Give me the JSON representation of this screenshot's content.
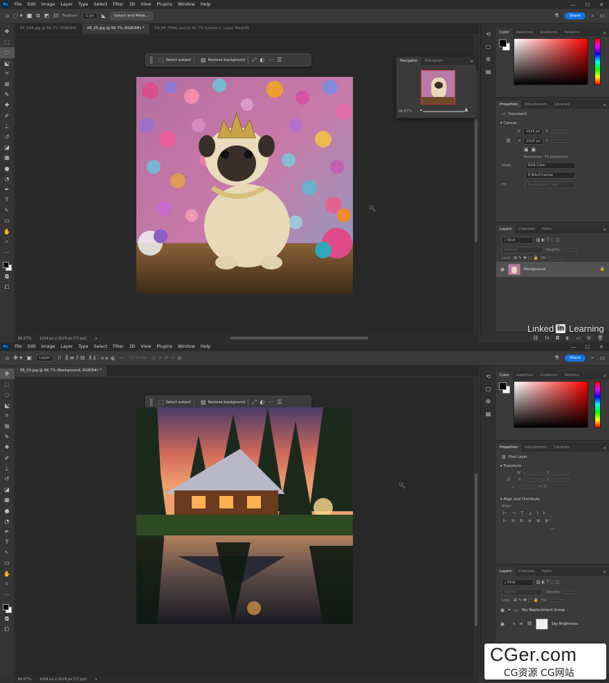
{
  "menu": [
    "File",
    "Edit",
    "Image",
    "Layer",
    "Type",
    "Select",
    "Filter",
    "3D",
    "View",
    "Plugins",
    "Window",
    "Help"
  ],
  "app_logo": "Ps",
  "window_controls": [
    "—",
    "☐",
    "✕"
  ],
  "top": {
    "options": {
      "feather_label": "Feather:",
      "feather_value": "1 px",
      "select_mask_label": "Select and Mask...",
      "share_label": "Share"
    },
    "tabs": [
      "04_04A.jpg @ 66.7% (RGB/8#)",
      "06_05.jpg @ 66.7% (RGB/8#) *",
      "04_06_FINAL.psd @ 66.7% (Levels 1, Layer Mask/8)"
    ],
    "active_tab": 1,
    "status": {
      "zoom": "66.67%",
      "dims": "1024 px x 1024 px (72 ppi)"
    },
    "ctx": {
      "select_subject": "Select subject",
      "remove_background": "Remove background"
    },
    "navigator": {
      "tabs": [
        "Navigator",
        "Histogram"
      ],
      "zoom": "66.67%"
    },
    "color_tabs": [
      "Color",
      "Swatches",
      "Gradients",
      "Patterns"
    ],
    "props_tabs": [
      "Properties",
      "Adjustments",
      "Libraries"
    ],
    "props": {
      "type_label": "Document",
      "canvas_section": "Canvas",
      "w_label": "W",
      "w_value": "1024 px",
      "h_label": "H",
      "h_value": "1024 px",
      "x_label": "X",
      "y_label": "Y",
      "resolution": "Resolution: 72 pixels/inch",
      "mode_label": "Mode",
      "mode_value": "RGB Color",
      "depth_value": "8 Bits/Channel",
      "fill_label": "Fill",
      "fill_value": "Background Color"
    },
    "layers_tabs": [
      "Layers",
      "Channels",
      "Paths"
    ],
    "layers": {
      "kind": "Kind",
      "blend": "Normal",
      "opacity_label": "Opacity:",
      "lock_label": "Lock:",
      "fill_label": "Fill:",
      "items": [
        {
          "name": "Background"
        }
      ]
    }
  },
  "bottom": {
    "options": {
      "layer_select": "Layer",
      "share_label": "Share",
      "mode_3d": "3D Mode:"
    },
    "tabs": [
      "06_03.jpg @ 66.7% (Background, RGB/8#) *"
    ],
    "active_tab": 0,
    "status": {
      "zoom": "66.67%",
      "dims": "1024 px x 1024 px (72 ppi)"
    },
    "ctx": {
      "select_subject": "Select subject",
      "remove_background": "Remove background"
    },
    "color_tabs": [
      "Color",
      "Swatches",
      "Gradients",
      "Patterns"
    ],
    "props_tabs": [
      "Properties",
      "Adjustments",
      "Libraries"
    ],
    "props": {
      "type_label": "Pixel Layer",
      "transform_section": "Transform",
      "w_label": "W",
      "h_label": "H",
      "x_label": "X",
      "y_label": "Y",
      "align_section": "Align and Distribute",
      "align_label": "Align:"
    },
    "layers_tabs": [
      "Layers",
      "Channels",
      "Paths"
    ],
    "layers": {
      "kind": "Kind",
      "blend": "Normal",
      "opacity_label": "Opacity:",
      "lock_label": "Lock:",
      "fill_label": "Fill:",
      "items": [
        {
          "name": "Sky Replacement Group"
        },
        {
          "name": "Sky Brightness"
        }
      ]
    }
  },
  "branding": {
    "linkedin_a": "Linked",
    "linkedin_box": "in",
    "linkedin_b": "Learning",
    "cger_main": "CGer.com",
    "cger_sub": "CG资源 CG网站"
  }
}
